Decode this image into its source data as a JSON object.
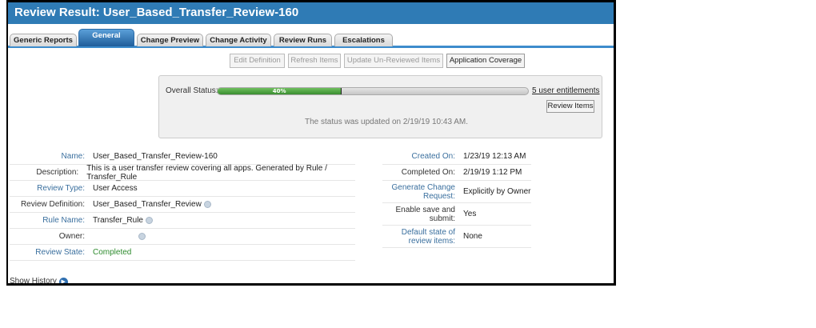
{
  "header": {
    "title": "Review Result: User_Based_Transfer_Review-160"
  },
  "tabs": [
    {
      "label": "Generic Reports"
    },
    {
      "label": "General"
    },
    {
      "label": "Change Preview"
    },
    {
      "label": "Change Activity"
    },
    {
      "label": "Review Runs"
    },
    {
      "label": "Escalations"
    }
  ],
  "active_tab": "General",
  "toolbar": {
    "edit": "Edit Definition",
    "refresh": "Refresh Items",
    "update": "Update Un-Reviewed Items",
    "coverage": "Application Coverage"
  },
  "status": {
    "label": "Overall Status:",
    "progress_percent": 40,
    "progress_text": "40%",
    "entitlements_link": "5 user entitlements",
    "review_items": "Review Items",
    "updated": "The status was updated on 2/19/19 10:43 AM."
  },
  "left_fields": [
    {
      "label": "Name:",
      "value": "User_Based_Transfer_Review-160"
    },
    {
      "label": "Description:",
      "value": "This is a user transfer review covering all apps. Generated by Rule / Transfer_Rule"
    },
    {
      "label": "Review Type:",
      "value": "User Access"
    },
    {
      "label": "Review Definition:",
      "value": "User_Based_Transfer_Review"
    },
    {
      "label": "Rule Name:",
      "value": "Transfer_Rule"
    },
    {
      "label": "Owner:",
      "value": ""
    },
    {
      "label": "Review State:",
      "value": "Completed"
    }
  ],
  "right_fields": [
    {
      "label": "Created On:",
      "value": "1/23/19 12:13 AM"
    },
    {
      "label": "Completed On:",
      "value": "2/19/19 1:12 PM"
    },
    {
      "label": "Generate Change Request:",
      "value": "Explicitly by Owner"
    },
    {
      "label": "Enable save and submit:",
      "value": "Yes"
    },
    {
      "label": "Default state of review items:",
      "value": "None"
    }
  ],
  "show_history": "Show History",
  "colors": {
    "header": "#2f7bb5",
    "progress": "#4a9e3c",
    "completed": "#2e8b2e"
  }
}
